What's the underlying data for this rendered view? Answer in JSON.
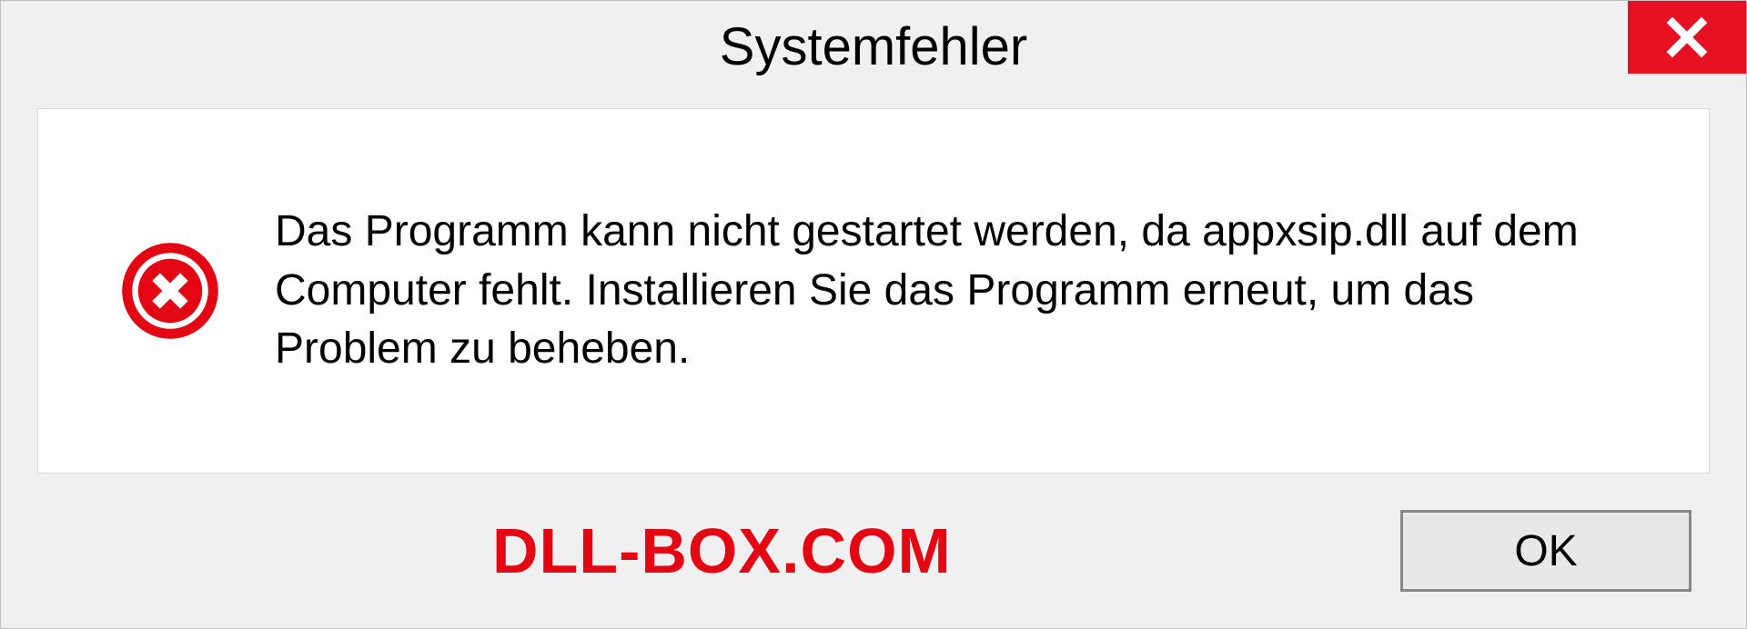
{
  "dialog": {
    "title": "Systemfehler",
    "message": "Das Programm kann nicht gestartet werden, da appxsip.dll auf dem Computer fehlt. Installieren Sie das Programm erneut, um das Problem zu beheben.",
    "ok_label": "OK"
  },
  "watermark": "DLL-BOX.COM"
}
